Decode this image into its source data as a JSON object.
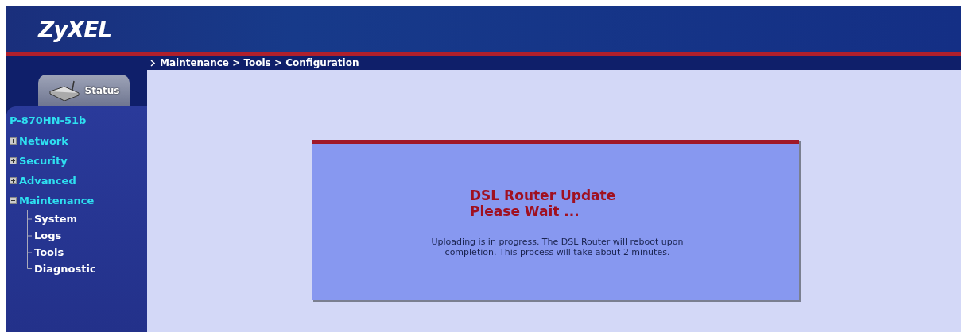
{
  "header": {
    "logo": "ZyXEL"
  },
  "breadcrumb": "Maintenance > Tools > Configuration",
  "sidebar": {
    "status_tab": "Status",
    "device": "P-870HN-51b",
    "menu": [
      {
        "label": "Network",
        "expanded": false
      },
      {
        "label": "Security",
        "expanded": false
      },
      {
        "label": "Advanced",
        "expanded": false
      },
      {
        "label": "Maintenance",
        "expanded": true,
        "children": [
          {
            "label": "System"
          },
          {
            "label": "Logs"
          },
          {
            "label": "Tools"
          },
          {
            "label": "Diagnostic"
          }
        ]
      }
    ]
  },
  "dialog": {
    "title": "DSL Router Update",
    "subtitle": "Please Wait ...",
    "message": "Uploading is in progress. The DSL Router will reboot upon completion. This process will take about 2 minutes."
  }
}
